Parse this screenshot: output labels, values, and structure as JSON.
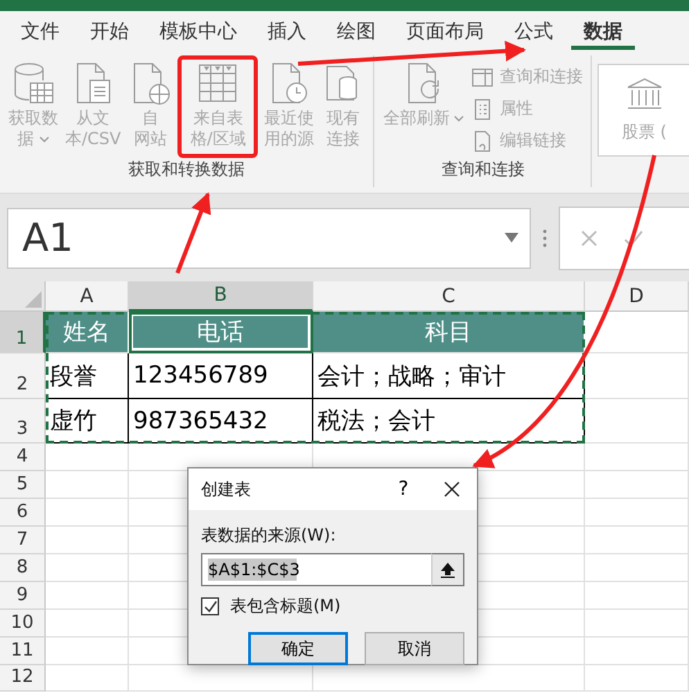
{
  "tabs": [
    {
      "label": "文件",
      "selected": false
    },
    {
      "label": "开始",
      "selected": false
    },
    {
      "label": "模板中心",
      "selected": false
    },
    {
      "label": "插入",
      "selected": false
    },
    {
      "label": "绘图",
      "selected": false
    },
    {
      "label": "页面布局",
      "selected": false
    },
    {
      "label": "公式",
      "selected": false
    },
    {
      "label": "数据",
      "selected": true
    }
  ],
  "ribbon": {
    "groups": [
      {
        "label": "获取和转换数据",
        "buttons": [
          {
            "kind": "large",
            "lines": [
              "获取数",
              "据"
            ],
            "dropdown": true,
            "disabled": true,
            "highlighted": false
          },
          {
            "kind": "large",
            "lines": [
              "从文",
              "本/CSV"
            ],
            "dropdown": false,
            "disabled": true,
            "highlighted": false
          },
          {
            "kind": "large",
            "lines": [
              "自",
              "网站"
            ],
            "dropdown": false,
            "disabled": true,
            "highlighted": false
          },
          {
            "kind": "large",
            "lines": [
              "来自表",
              "格/区域"
            ],
            "dropdown": false,
            "disabled": true,
            "highlighted": true
          },
          {
            "kind": "large",
            "lines": [
              "最近使",
              "用的源"
            ],
            "dropdown": false,
            "disabled": true,
            "highlighted": false
          },
          {
            "kind": "large",
            "lines": [
              "现有",
              "连接"
            ],
            "dropdown": false,
            "disabled": true,
            "highlighted": false
          }
        ]
      },
      {
        "label": "查询和连接",
        "buttons": [
          {
            "kind": "large",
            "lines": [
              "全部刷新"
            ],
            "dropdown": true,
            "disabled": true,
            "highlighted": false
          },
          {
            "kind": "small",
            "lines": [
              "查询和连接"
            ],
            "disabled": true
          },
          {
            "kind": "small",
            "lines": [
              "属性"
            ],
            "disabled": true
          },
          {
            "kind": "small",
            "lines": [
              "编辑链接"
            ],
            "disabled": true
          }
        ]
      },
      {
        "buttons": [
          {
            "kind": "card",
            "lines": [
              "股票 ("
            ],
            "disabled": true
          }
        ]
      }
    ]
  },
  "name_box": {
    "value": "A1"
  },
  "sheet": {
    "columns": [
      {
        "label": "A",
        "selected": false
      },
      {
        "label": "B",
        "selected": true
      },
      {
        "label": "C",
        "selected": false
      },
      {
        "label": "D",
        "selected": false
      }
    ],
    "rows": [
      {
        "label": "1",
        "selected": true,
        "kind": "header",
        "cells": [
          {
            "text": "姓名",
            "active": false
          },
          {
            "text": "电话",
            "active": true
          },
          {
            "text": "科目",
            "active": false
          }
        ]
      },
      {
        "label": "2",
        "selected": false,
        "kind": "data",
        "cells": [
          {
            "text": "段誉",
            "active": false
          },
          {
            "text": "123456789",
            "active": false
          },
          {
            "text": "会计；战略；审计",
            "active": false
          }
        ]
      },
      {
        "label": "3",
        "selected": false,
        "kind": "data",
        "cells": [
          {
            "text": "虚竹",
            "active": false
          },
          {
            "text": "987365432",
            "active": false
          },
          {
            "text": "税法；会计",
            "active": false
          }
        ]
      },
      {
        "label": "4",
        "selected": false,
        "kind": "empty"
      },
      {
        "label": "5",
        "selected": false,
        "kind": "empty"
      },
      {
        "label": "6",
        "selected": false,
        "kind": "empty"
      },
      {
        "label": "7",
        "selected": false,
        "kind": "empty"
      },
      {
        "label": "8",
        "selected": false,
        "kind": "empty"
      },
      {
        "label": "9",
        "selected": false,
        "kind": "empty"
      },
      {
        "label": "10",
        "selected": false,
        "kind": "empty"
      },
      {
        "label": "11",
        "selected": false,
        "kind": "empty"
      },
      {
        "label": "12",
        "selected": false,
        "kind": "empty"
      }
    ]
  },
  "dialog": {
    "title": "创建表",
    "help": "?",
    "source_label": "表数据的来源(W):",
    "source_value": "$A$1:$C$3",
    "header_checkbox": {
      "label": "表包含标题(M)",
      "checked": true
    },
    "buttons": [
      {
        "label": "确定",
        "default": true
      },
      {
        "label": "取消",
        "default": false
      }
    ]
  }
}
